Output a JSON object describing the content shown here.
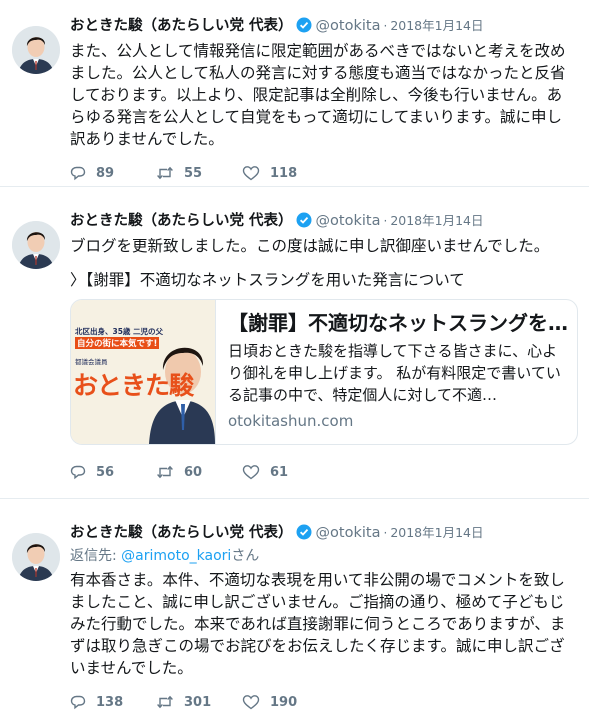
{
  "tweets": [
    {
      "name": "おときた駿（あたらしい党 代表）",
      "handle": "@otokita",
      "dot": "·",
      "time": "2018年1月14日",
      "text": "また、公人として情報発信に限定範囲があるべきではないと考えを改めました。公人として私人の発言に対する態度も適当ではなかったと反省しております。以上より、限定記事は全削除し、今後も行いません。あらゆる発言を公人として自覚をもって適切にしてまいります。誠に申し訳ありませんでした。",
      "replies": "89",
      "retweets": "55",
      "likes": "118"
    },
    {
      "name": "おときた駿（あたらしい党 代表）",
      "handle": "@otokita",
      "dot": "·",
      "time": "2018年1月14日",
      "text": "ブログを更新致しました。この度は誠に申し訳御座いませんでした。",
      "link_text": "〉【謝罪】不適切なネットスラングを用いた発言について",
      "card": {
        "title": "【謝罪】不適切なネットスラングを用いた発言について",
        "description": "日頃おときた駿を指導して下さる皆さまに、心より御礼を申し上げます。 私が有料限定で書いている記事の中で、特定個人に対して不適…",
        "domain": "otokitashun.com",
        "img_line1": "北区出身、35歳 二児の父",
        "img_line2": "自分の街に本気です!",
        "img_line3": "都議会議員",
        "img_logo": "おときた駿"
      },
      "replies": "56",
      "retweets": "60",
      "likes": "61"
    },
    {
      "name": "おときた駿（あたらしい党 代表）",
      "handle": "@otokita",
      "dot": "·",
      "time": "2018年1月14日",
      "reply_prefix": "返信先: ",
      "reply_handle": "@arimoto_kaori",
      "reply_suffix": "さん",
      "text": "有本香さま。本件、不適切な表現を用いて非公開の場でコメントを致しましたこと、誠に申し訳ございません。ご指摘の通り、極めて子どもじみた行動でした。本来であれば直接謝罪に伺うところでありますが、まずは取り急ぎこの場でお詫びをお伝えしたく存じます。誠に申し訳ございませんでした。",
      "replies": "138",
      "retweets": "301",
      "likes": "190"
    }
  ],
  "colors": {
    "accent": "#1da1f2",
    "muted": "#657786",
    "text": "#14171a",
    "divider": "#e6ecf0"
  },
  "icons": [
    "avatar",
    "verified-badge-icon",
    "reply-icon",
    "retweet-icon",
    "like-icon"
  ]
}
